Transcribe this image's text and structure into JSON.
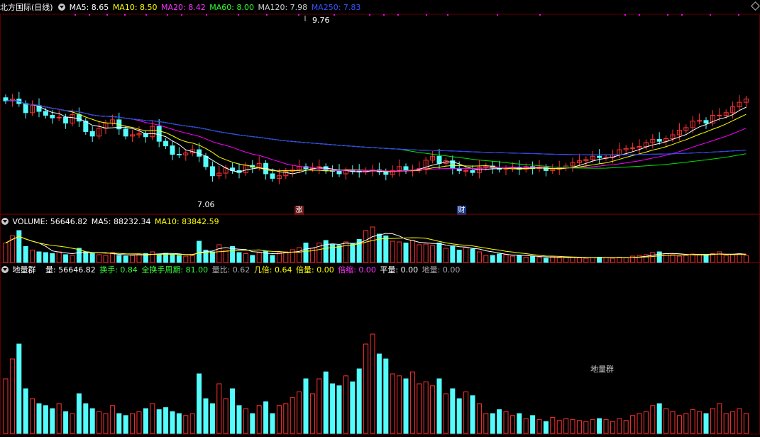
{
  "header_main": {
    "title": "北方国际(日线)",
    "ma5": "MA5: 8.65",
    "ma10": "MA10: 8.50",
    "ma20": "MA20: 8.42",
    "ma60": "MA60: 8.00",
    "ma120": "MA120: 7.98",
    "ma250": "MA250: 7.83"
  },
  "header_volume": {
    "volume": "VOLUME: 56646.82",
    "ma5": "MA5: 88232.34",
    "ma10": "MA10: 83842.59"
  },
  "header_indicator": {
    "name": "地量群",
    "liang": "量: 56646.82",
    "huanshou": "换手: 0.84",
    "quan": "全换手周期: 81.00",
    "liangbi": "量比: 0.62",
    "jibei": "几倍: 0.64",
    "beiliang": "倍量: 0.00",
    "beisuo": "倍缩: 0.00",
    "pingliang": "平量: 0.00",
    "diliang": "地量: 0.00"
  },
  "annotations": {
    "high": "9.76",
    "low": "7.06",
    "zhang": "涨",
    "cai": "财",
    "indicator_label": "地量群"
  },
  "colors": {
    "up": "#ff3232",
    "down": "#54fcfc",
    "ma5": "#ffffff",
    "ma10": "#ffff00",
    "ma20": "#ff00ff",
    "ma60": "#00e600",
    "ma120": "#c8c8c8",
    "ma250": "#1f3cff"
  },
  "chart_data": {
    "type": "candlestick",
    "price_high": 9.76,
    "price_low": 7.06,
    "closes": [
      8.62,
      8.65,
      8.58,
      8.44,
      8.55,
      8.46,
      8.4,
      8.36,
      8.37,
      8.28,
      8.41,
      8.31,
      8.15,
      8.08,
      8.2,
      8.28,
      8.33,
      8.19,
      8.08,
      8.1,
      8.12,
      8.07,
      8.23,
      8.0,
      7.93,
      7.8,
      7.79,
      7.82,
      7.87,
      7.77,
      7.61,
      7.47,
      7.51,
      7.59,
      7.55,
      7.52,
      7.63,
      7.6,
      7.66,
      7.5,
      7.43,
      7.47,
      7.54,
      7.56,
      7.61,
      7.58,
      7.59,
      7.61,
      7.55,
      7.54,
      7.5,
      7.55,
      7.54,
      7.53,
      7.55,
      7.56,
      7.53,
      7.49,
      7.55,
      7.61,
      7.55,
      7.56,
      7.58,
      7.71,
      7.77,
      7.66,
      7.7,
      7.58,
      7.55,
      7.55,
      7.52,
      7.6,
      7.62,
      7.59,
      7.57,
      7.58,
      7.6,
      7.57,
      7.61,
      7.58,
      7.6,
      7.55,
      7.57,
      7.59,
      7.62,
      7.67,
      7.7,
      7.72,
      7.77,
      7.75,
      7.75,
      7.79,
      7.87,
      7.89,
      7.9,
      7.92,
      7.98,
      8.03,
      8.0,
      8.04,
      8.1,
      8.17,
      8.21,
      8.31,
      8.32,
      8.28,
      8.4,
      8.4,
      8.44,
      8.53,
      8.6,
      8.65
    ],
    "volume_series": {
      "volume": 56646.82,
      "ma5": 88232.34,
      "ma10": 83842.59,
      "values": [
        0.55,
        0.75,
        0.9,
        0.45,
        0.35,
        0.3,
        0.28,
        0.25,
        0.3,
        0.22,
        0.2,
        0.4,
        0.3,
        0.25,
        0.22,
        0.2,
        0.28,
        0.2,
        0.18,
        0.2,
        0.22,
        0.25,
        0.3,
        0.24,
        0.26,
        0.22,
        0.2,
        0.18,
        0.2,
        0.6,
        0.35,
        0.3,
        0.5,
        0.35,
        0.45,
        0.28,
        0.25,
        0.2,
        0.28,
        0.32,
        0.2,
        0.28,
        0.3,
        0.36,
        0.42,
        0.55,
        0.4,
        0.55,
        0.62,
        0.5,
        0.48,
        0.58,
        0.52,
        0.65,
        0.9,
        1.0,
        0.8,
        0.75,
        0.6,
        0.58,
        0.55,
        0.62,
        0.5,
        0.52,
        0.48,
        0.55,
        0.4,
        0.45,
        0.35,
        0.42,
        0.38,
        0.3,
        0.2,
        0.2,
        0.24,
        0.22,
        0.18,
        0.2,
        0.15,
        0.18,
        0.14,
        0.12,
        0.16,
        0.13,
        0.15,
        0.14,
        0.13,
        0.12,
        0.14,
        0.15,
        0.14,
        0.12,
        0.15,
        0.13,
        0.18,
        0.2,
        0.22,
        0.28,
        0.3,
        0.25,
        0.22,
        0.18,
        0.2,
        0.24,
        0.22,
        0.2,
        0.25,
        0.3,
        0.2,
        0.22,
        0.25,
        0.2
      ]
    },
    "indicator_series": {
      "name": "地量群"
    }
  }
}
